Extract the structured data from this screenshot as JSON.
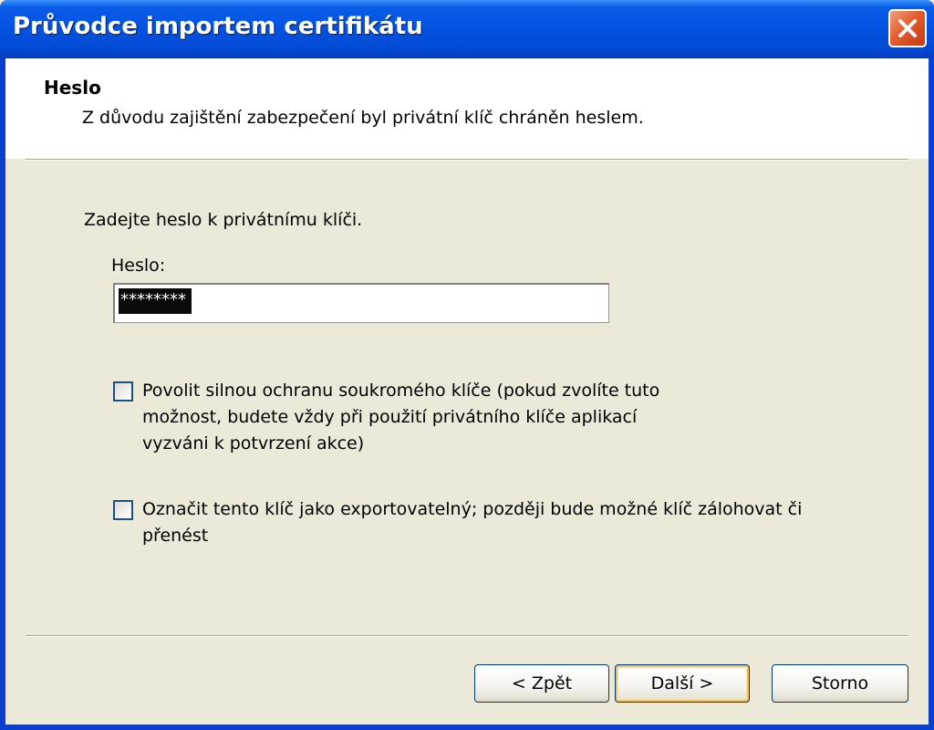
{
  "window": {
    "title": "Průvodce importem certifikátu"
  },
  "header": {
    "title": "Heslo",
    "subtitle": "Z důvodu zajištění zabezpečení byl privátní klíč chráněn heslem."
  },
  "content": {
    "prompt": "Zadejte heslo k privátnímu klíči.",
    "password_label": "Heslo:",
    "password_value": "********",
    "options": [
      {
        "label": "Povolit silnou ochranu soukromého klíče (pokud zvolíte tuto možnost, budete vždy při použití privátního klíče aplikací vyzváni k potvrzení akce)",
        "checked": false
      },
      {
        "label": "Označit tento klíč jako exportovatelný; později bude možné klíč zálohovat či přenést",
        "checked": false
      }
    ]
  },
  "buttons": {
    "back": "< Zpět",
    "next": "Další >",
    "cancel": "Storno"
  }
}
